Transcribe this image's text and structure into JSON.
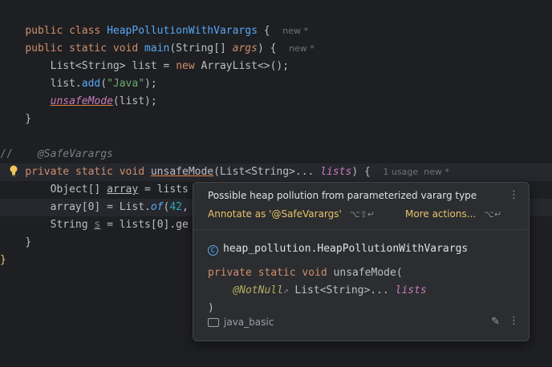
{
  "code": {
    "l1": {
      "kw": "public class ",
      "name": "HeapPollutionWithVarargs",
      "brace": " {",
      "hint": "new *"
    },
    "l3": {
      "kw": "public static void ",
      "fn": "main",
      "p1": "(",
      "type": "String",
      "p2": "[] ",
      "param": "args",
      "p3": ") {",
      "hint": "new *"
    },
    "l4": {
      "t1": "List<",
      "t2": "String",
      "t3": "> list = ",
      "kw": "new ",
      "t4": "ArrayList<>();"
    },
    "l5": {
      "t1": "list.",
      "fn": "add",
      "t2": "(",
      "str": "\"Java\"",
      "t3": ");"
    },
    "l6": {
      "fn": "unsafeMode",
      "t1": "(list);"
    },
    "l7": {
      "t1": "}"
    },
    "l9": {
      "cmt1": "//",
      "cmt2": "@SafeVarargs"
    },
    "l10": {
      "kw": "private static void ",
      "fn": "unsafeMode",
      "t1": "(List<String>... ",
      "param": "lists",
      "t2": ") {",
      "hint": "1 usage  new *"
    },
    "l11": {
      "t1": "Object[] ",
      "var": "array",
      "t2": " = lists"
    },
    "l12": {
      "t1": "array[0] = List.",
      "fn": "of",
      "t2": "(",
      "num": "42",
      "t3": ","
    },
    "l13": {
      "t1": "String ",
      "var": "s",
      "t2": " = lists[0].ge"
    },
    "l14": {
      "t1": "}"
    },
    "l15": {
      "t1": "}"
    }
  },
  "popup": {
    "title": "Possible heap pollution from parameterized vararg type",
    "action1": "Annotate as '@SafeVarargs'",
    "action1_key": "⌥⇧↵",
    "action2": "More actions...",
    "action2_key": "⌥↵",
    "class_icon": "C",
    "qualified_name": "heap_pollution.HeapPollutionWithVarargs",
    "sig_kw": "private static void ",
    "sig_name": "unsafeMode(",
    "sig_ann": "@NotNull",
    "sig_arrow": "↗",
    "sig_type": " List<String>... ",
    "sig_param": "lists",
    "sig_close": ")",
    "module": "java_basic"
  },
  "icons": [
    "lightbulb-icon",
    "class-icon",
    "folder-module-icon",
    "edit-pencil-icon",
    "more-options-icon"
  ]
}
